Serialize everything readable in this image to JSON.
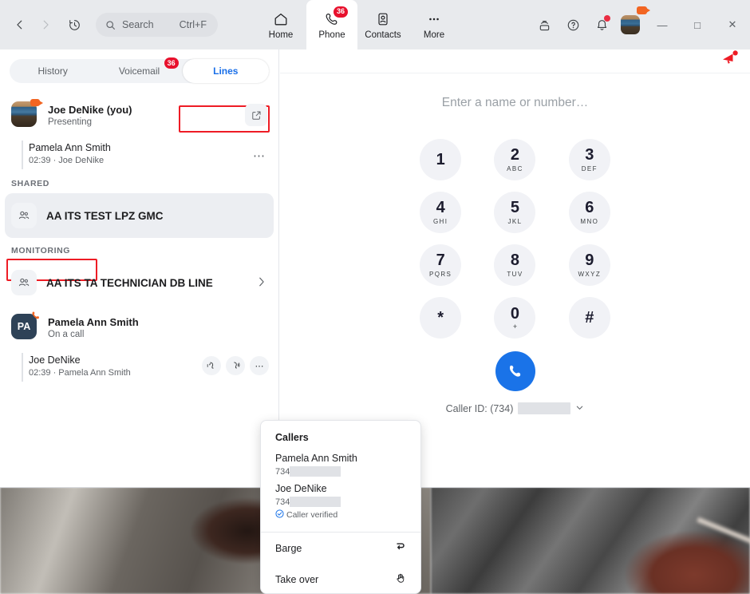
{
  "titlebar": {
    "nav": {
      "back": "‹",
      "forward": "›",
      "history_icon": "history-icon"
    },
    "search": {
      "placeholder": "Search",
      "shortcut": "Ctrl+F",
      "icon": "search-icon"
    },
    "tabs": [
      {
        "label": "Home",
        "icon": "home-icon",
        "badge": "",
        "active": false
      },
      {
        "label": "Phone",
        "icon": "phone-icon",
        "badge": "36",
        "active": true
      },
      {
        "label": "Contacts",
        "icon": "contacts-icon",
        "badge": "",
        "active": false
      },
      {
        "label": "More",
        "icon": "more-icon",
        "badge": "",
        "active": false
      }
    ],
    "right_icons": [
      {
        "name": "cast-icon"
      },
      {
        "name": "help-icon"
      },
      {
        "name": "notifications-bell-icon"
      },
      {
        "name": "user-avatar"
      }
    ],
    "window_controls": {
      "minimize": "—",
      "maximize": "□",
      "close": "✕"
    }
  },
  "left_panel": {
    "tabs": [
      {
        "label": "History",
        "active": false,
        "badge": ""
      },
      {
        "label": "Voicemail",
        "active": false,
        "badge": "36"
      },
      {
        "label": "Lines",
        "active": true,
        "badge": ""
      }
    ],
    "self_entry": {
      "name": "Joe DeNike (you)",
      "status": "Presenting",
      "action_icon": "open-external-icon"
    },
    "self_call": {
      "name": "Pamela Ann Smith",
      "meta": "02:39 · Joe DeNike",
      "more_icon": "more-dots-icon"
    },
    "shared_label": "SHARED",
    "shared_lines": [
      {
        "name": "AA ITS TEST LPZ GMC",
        "icon": "group-line-icon",
        "selected": true
      }
    ],
    "monitoring_label": "MONITORING",
    "monitoring_lines": [
      {
        "name": "AA ITS TA TECHNICIAN DB LINE",
        "icon": "group-line-icon",
        "chevron": "›"
      }
    ],
    "monitored_contact": {
      "initials": "PA",
      "name": "Pamela Ann Smith",
      "status": "On a call",
      "badge_icon": "active-call-icon"
    },
    "monitored_call": {
      "name": "Joe DeNike",
      "meta": "02:39 · Pamela Ann Smith",
      "actions": [
        {
          "name": "listen-icon"
        },
        {
          "name": "whisper-icon"
        },
        {
          "name": "more-dots-icon"
        }
      ]
    }
  },
  "right_panel": {
    "announcement_icon": "megaphone-icon",
    "dial_placeholder": "Enter a name or number…",
    "keys": [
      {
        "digit": "1",
        "letters": ""
      },
      {
        "digit": "2",
        "letters": "ABC"
      },
      {
        "digit": "3",
        "letters": "DEF"
      },
      {
        "digit": "4",
        "letters": "GHI"
      },
      {
        "digit": "5",
        "letters": "JKL"
      },
      {
        "digit": "6",
        "letters": "MNO"
      },
      {
        "digit": "7",
        "letters": "PQRS"
      },
      {
        "digit": "8",
        "letters": "TUV"
      },
      {
        "digit": "9",
        "letters": "WXYZ"
      },
      {
        "digit": "*",
        "letters": ""
      },
      {
        "digit": "0",
        "letters": "+"
      },
      {
        "digit": "#",
        "letters": ""
      }
    ],
    "call_button_icon": "call-icon",
    "caller_id_label": "Caller ID: (734)",
    "caller_id_value_redacted": true,
    "caller_id_chevron": "⌄"
  },
  "popup": {
    "title": "Callers",
    "callers": [
      {
        "name": "Pamela Ann Smith",
        "number_prefix": "734",
        "verified": false,
        "verified_label": ""
      },
      {
        "name": "Joe DeNike",
        "number_prefix": "734",
        "verified": true,
        "verified_label": "Caller verified"
      }
    ],
    "actions": [
      {
        "label": "Barge",
        "icon": "barge-arrow-icon"
      },
      {
        "label": "Take over",
        "icon": "take-over-hand-icon"
      }
    ]
  },
  "colors": {
    "accent_blue": "#1a73e8",
    "badge_red": "#e8112d",
    "highlight_red": "#ee1c25",
    "titlebar_bg": "#e8eaed",
    "panel_bg": "#ffffff",
    "selected_row": "#eceef2"
  }
}
